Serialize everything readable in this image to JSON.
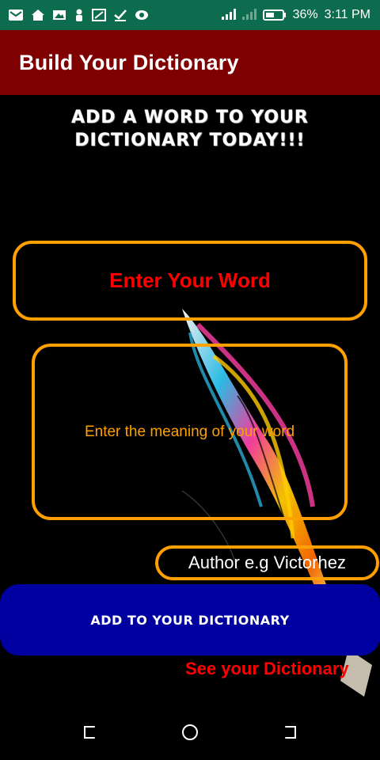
{
  "status_bar": {
    "battery_percent": "36%",
    "time": "3:11 PM",
    "icons": [
      "gmail-icon",
      "home-icon",
      "image-icon",
      "person-icon",
      "cast-icon",
      "check-icon",
      "eye-icon",
      "signal-icon",
      "battery-icon"
    ]
  },
  "app_bar": {
    "title": "Build Your Dictionary"
  },
  "main": {
    "headline": "ADD A WORD TO YOUR DICTIONARY TODAY!!!",
    "word_field": {
      "placeholder": "Enter Your Word"
    },
    "meaning_field": {
      "placeholder": "Enter the meaning of your word"
    },
    "author_field": {
      "placeholder": "Author e.g Victorhez"
    },
    "add_button_label": "ADD TO YOUR DICTIONARY",
    "see_link": "See your Dictionary"
  },
  "nav_bar": {
    "icons": [
      "back-icon",
      "home-circle-icon",
      "recents-icon"
    ]
  },
  "colors": {
    "status_bar": "#0d6b4e",
    "app_bar": "#7f0000",
    "accent_orange": "#ffa000",
    "button_blue": "#0000a0",
    "red_text": "#ff0000"
  }
}
